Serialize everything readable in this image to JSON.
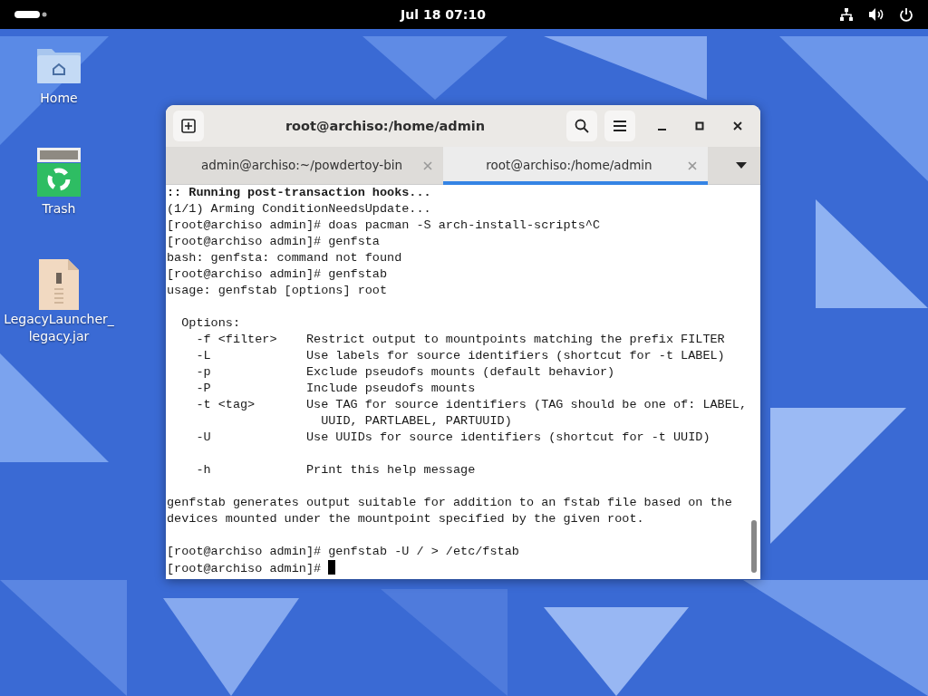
{
  "top_bar": {
    "clock": "Jul 18  07:10"
  },
  "desktop_icons": [
    {
      "kind": "folder",
      "label": "Home"
    },
    {
      "kind": "trash",
      "label": "Trash"
    },
    {
      "kind": "file",
      "label": "LegacyLauncher_ legacy.jar"
    }
  ],
  "terminal": {
    "title": "root@archiso:/home/admin",
    "tabs": [
      {
        "label": "admin@archiso:~/powdertoy-bin",
        "selected": false
      },
      {
        "label": "root@archiso:/home/admin",
        "selected": true
      }
    ],
    "blocks": [
      [
        {
          "text": ":: Running post-transaction hooks...",
          "bold": true
        },
        {
          "text": "(1/1) Arming ConditionNeedsUpdate..."
        },
        {
          "text": "[root@archiso admin]# doas pacman -S arch-install-scripts^C"
        },
        {
          "text": "[root@archiso admin]# genfsta"
        },
        {
          "text": "bash: genfsta: command not found"
        },
        {
          "text": "[root@archiso admin]# genfstab"
        },
        {
          "text": "usage: genfstab [options] root"
        }
      ],
      [
        {
          "text": "  Options:"
        },
        {
          "text": "    -f <filter>    Restrict output to mountpoints matching the prefix FILTER"
        },
        {
          "text": "    -L             Use labels for source identifiers (shortcut for -t LABEL)"
        },
        {
          "text": "    -p             Exclude pseudofs mounts (default behavior)"
        },
        {
          "text": "    -P             Include pseudofs mounts"
        },
        {
          "text": "    -t <tag>       Use TAG for source identifiers (TAG should be one of: LABEL,"
        },
        {
          "text": "                     UUID, PARTLABEL, PARTUUID)"
        },
        {
          "text": "    -U             Use UUIDs for source identifiers (shortcut for -t UUID)"
        }
      ],
      [
        {
          "text": "    -h             Print this help message"
        }
      ],
      [
        {
          "text": "genfstab generates output suitable for addition to an fstab file based on the"
        },
        {
          "text": "devices mounted under the mountpoint specified by the given root."
        }
      ],
      [
        {
          "text": "[root@archiso admin]# genfstab -U / > /etc/fstab"
        },
        {
          "text": "[root@archiso admin]# ",
          "cursor": true
        }
      ]
    ]
  }
}
